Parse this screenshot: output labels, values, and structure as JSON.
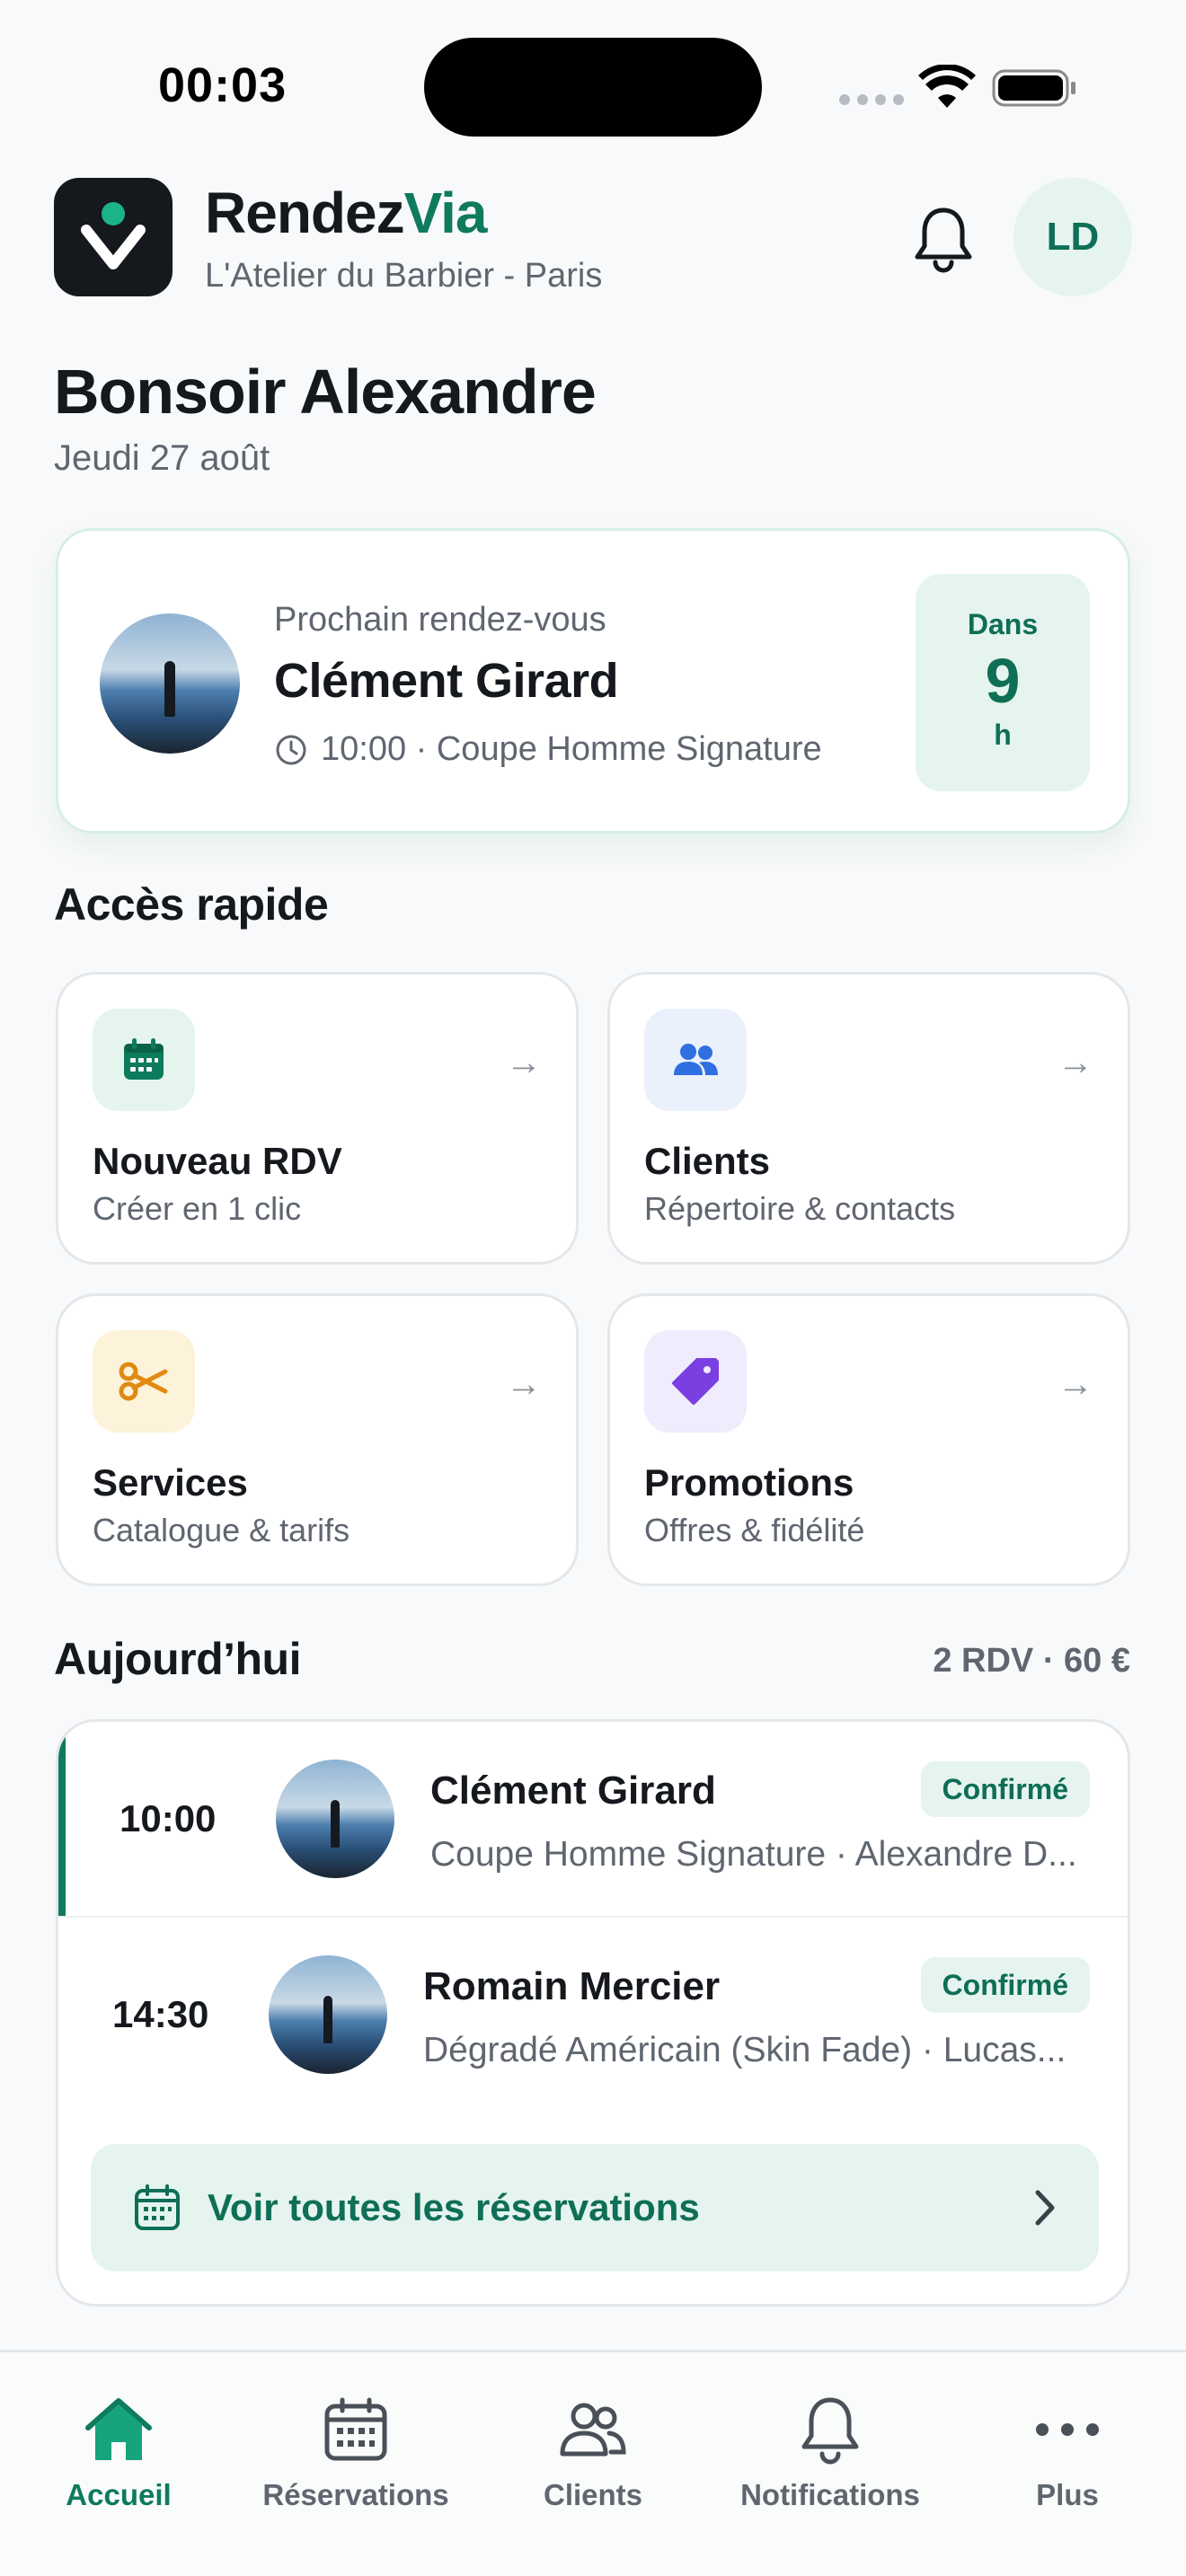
{
  "status_bar": {
    "time": "00:03"
  },
  "header": {
    "brand_part1": "Rendez",
    "brand_part2": "Via",
    "salon": "L'Atelier du Barbier - Paris",
    "avatar_initials": "LD",
    "icons": {
      "notifications": "bell-icon"
    }
  },
  "greeting": {
    "title": "Bonsoir Alexandre",
    "date": "Jeudi 27 août"
  },
  "next_appointment": {
    "label": "Prochain rendez-vous",
    "client": "Clément Girard",
    "meta": "10:00 · Coupe Homme Signature",
    "countdown_prefix": "Dans",
    "countdown_value": "9",
    "countdown_unit": "h"
  },
  "quick_access": {
    "title": "Accès rapide",
    "tiles": [
      {
        "title": "Nouveau RDV",
        "subtitle": "Créer en 1 clic",
        "icon": "calendar-icon",
        "color": "#0e7a5e",
        "bg": "#e5f4ee"
      },
      {
        "title": "Clients",
        "subtitle": "Répertoire & contacts",
        "icon": "users-icon",
        "color": "#2f6fe0",
        "bg": "#eaf1fd"
      },
      {
        "title": "Services",
        "subtitle": "Catalogue & tarifs",
        "icon": "scissors-icon",
        "color": "#e08a12",
        "bg": "#fdf3da"
      },
      {
        "title": "Promotions",
        "subtitle": "Offres & fidélité",
        "icon": "tag-icon",
        "color": "#7a3fe0",
        "bg": "#f0ecfd"
      }
    ]
  },
  "today": {
    "title": "Aujourd’hui",
    "summary": "2 RDV · 60 €",
    "appointments": [
      {
        "time": "10:00",
        "client": "Clément Girard",
        "status": "Confirmé",
        "detail": "Coupe Homme Signature · Alexandre D..."
      },
      {
        "time": "14:30",
        "client": "Romain Mercier",
        "status": "Confirmé",
        "detail": "Dégradé Américain (Skin Fade) · Lucas..."
      }
    ],
    "view_all": "Voir toutes les réservations"
  },
  "tab_bar": {
    "tabs": [
      {
        "label": "Accueil",
        "icon": "home-icon",
        "active": true
      },
      {
        "label": "Réservations",
        "icon": "calendar-icon",
        "active": false
      },
      {
        "label": "Clients",
        "icon": "users-icon",
        "active": false
      },
      {
        "label": "Notifications",
        "icon": "bell-icon",
        "active": false
      },
      {
        "label": "Plus",
        "icon": "more-icon",
        "active": false
      }
    ]
  },
  "colors": {
    "accent": "#0e7a5e",
    "accent_light": "#e5f4ee",
    "text": "#15181d",
    "muted": "#5f6670"
  }
}
